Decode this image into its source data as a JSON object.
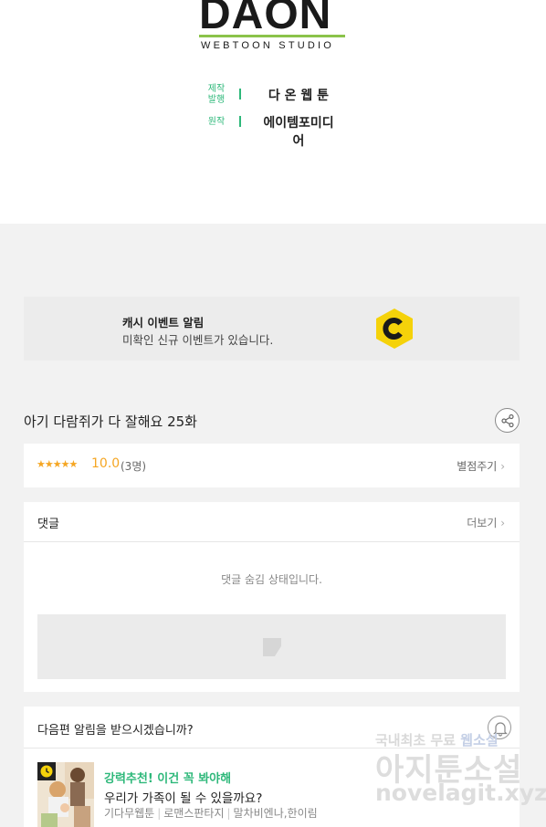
{
  "studio": {
    "logo_main": "DAON",
    "logo_sub": "WEBTOON STUDIO",
    "credits": [
      {
        "label": "제작\n발행",
        "value": "다 온 웹 툰"
      },
      {
        "label": "원작",
        "value": "에이템포미디어"
      }
    ]
  },
  "banner": {
    "title": "캐시 이벤트 알림",
    "description": "미확인 신규 이벤트가 있습니다.",
    "icon": "cash-c-icon",
    "icon_color": "#f5d20a"
  },
  "episode": {
    "title": "아기 다람쥐가 다 잘해요 25화",
    "share_icon": "share-icon"
  },
  "rating": {
    "stars": "★★★★★",
    "score": "10.0",
    "count": "(3명)",
    "rate_link": "별점주기",
    "star_color": "#f5a623"
  },
  "comments": {
    "title": "댓글",
    "more": "더보기",
    "hidden_message": "댓글 숨김 상태입니다."
  },
  "notify": {
    "title": "다음편 알림을 받으시겠습니까?",
    "bell_icon": "bell-icon"
  },
  "recommend": {
    "tag": "강력추천! 이건 꼭 봐야해",
    "title": "우리가 가족이 될 수 있을까요?",
    "meta": [
      "기다무웹툰",
      "로맨스판타지",
      "말차비엔나,한이림"
    ],
    "accent": "#2eb87a"
  },
  "watermark": {
    "line1_a": "국내최초 무료",
    "line1_b": "웹소설",
    "line2": "아지툰소설",
    "line3": "novelagit.xyz"
  },
  "chevron": "›"
}
